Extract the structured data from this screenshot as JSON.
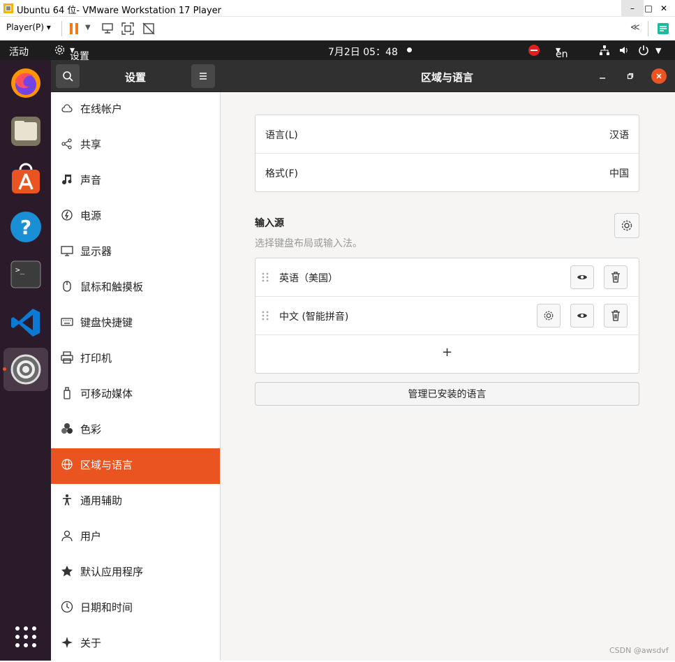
{
  "vm": {
    "title": "Ubuntu 64 位- VMware Workstation 17 Player",
    "player_menu": "Player(P)",
    "min": "–",
    "max": "□",
    "close": "✕",
    "collapse": "≪"
  },
  "topbar": {
    "activities": "活动",
    "app_menu": "设置",
    "clock": "7月2日  05：48",
    "keyboard": "en"
  },
  "dock": {
    "apps": [
      {
        "name": "firefox-icon"
      },
      {
        "name": "files-icon"
      },
      {
        "name": "app-center-icon"
      },
      {
        "name": "help-icon"
      },
      {
        "name": "terminal-icon"
      },
      {
        "name": "vscode-icon"
      },
      {
        "name": "settings-app-icon"
      }
    ]
  },
  "sidebar": {
    "title": "设置",
    "items": [
      {
        "label": "在线帐户",
        "icon": "cloud-icon"
      },
      {
        "label": "共享",
        "icon": "share-icon"
      },
      {
        "label": "声音",
        "icon": "music-note-icon"
      },
      {
        "label": "电源",
        "icon": "power-icon"
      },
      {
        "label": "显示器",
        "icon": "display-icon"
      },
      {
        "label": "鼠标和触摸板",
        "icon": "mouse-icon"
      },
      {
        "label": "键盘快捷键",
        "icon": "keyboard-icon"
      },
      {
        "label": "打印机",
        "icon": "printer-icon"
      },
      {
        "label": "可移动媒体",
        "icon": "removable-media-icon"
      },
      {
        "label": "色彩",
        "icon": "color-icon"
      },
      {
        "label": "区域与语言",
        "icon": "globe-icon"
      },
      {
        "label": "通用辅助",
        "icon": "accessibility-icon"
      },
      {
        "label": "用户",
        "icon": "user-icon"
      },
      {
        "label": "默认应用程序",
        "icon": "star-icon"
      },
      {
        "label": "日期和时间",
        "icon": "clock-icon"
      },
      {
        "label": "关于",
        "icon": "sparkle-icon"
      }
    ],
    "active_index": 10
  },
  "main": {
    "title": "区域与语言",
    "language_label": "语言(L)",
    "language_value": "汉语",
    "formats_label": "格式(F)",
    "formats_value": "中国",
    "input_sources_title": "输入源",
    "input_sources_desc": "选择键盘布局或输入法。",
    "sources": [
      {
        "label": "英语（美国）"
      },
      {
        "label": "中文 (智能拼音)"
      }
    ],
    "add_label": "+",
    "manage_button": "管理已安装的语言"
  },
  "watermark": "CSDN @awsdvf",
  "colors": {
    "accent": "#e95420",
    "headerbar": "#303030",
    "topbar": "#1d1d1d",
    "dock": "#2b1b2a"
  }
}
